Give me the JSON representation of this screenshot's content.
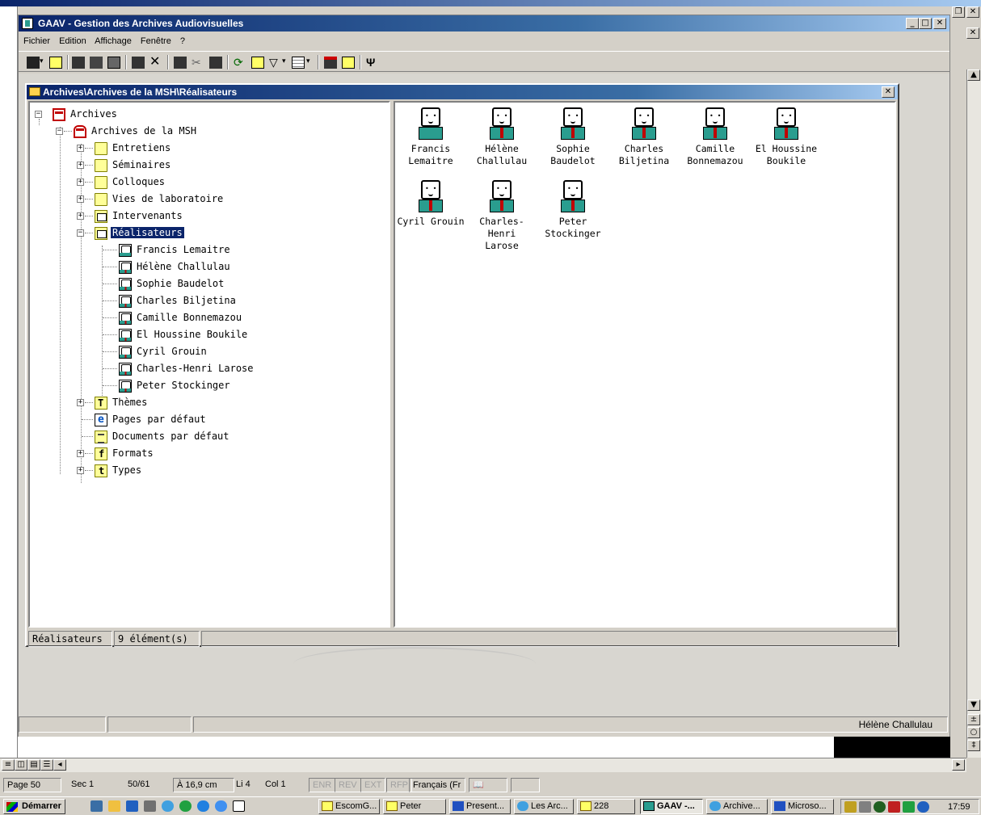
{
  "gaav_window": {
    "title": "GAAV - Gestion des Archives Audiovisuelles",
    "menu": [
      "Fichier",
      "Edition",
      "Affichage",
      "Fenêtre",
      "?"
    ]
  },
  "child_window": {
    "title": "Archives\\Archives de la MSH\\Réalisateurs"
  },
  "tree": {
    "root": "Archives",
    "msh": "Archives de la MSH",
    "folders": [
      "Entretiens",
      "Séminaires",
      "Colloques",
      "Vies de laboratoire"
    ],
    "intervenants": "Intervenants",
    "realisateurs": "Réalisateurs",
    "people": [
      "Francis Lemaitre",
      "Hélène Challulau",
      "Sophie Baudelot",
      "Charles Biljetina",
      "Camille Bonnemazou",
      "El Houssine Boukile",
      "Cyril Grouin",
      "Charles-Henri Larose",
      "Peter Stockinger"
    ],
    "themes": "Thèmes",
    "pages": "Pages par défaut",
    "documents": "Documents par défaut",
    "formats": "Formats",
    "types": "Types"
  },
  "list_view": {
    "items": [
      {
        "line1": "Francis",
        "line2": "Lemaitre"
      },
      {
        "line1": "Hélène",
        "line2": "Challulau"
      },
      {
        "line1": "Sophie",
        "line2": "Baudelot"
      },
      {
        "line1": "Charles",
        "line2": "Biljetina"
      },
      {
        "line1": "Camille",
        "line2": "Bonnemazou"
      },
      {
        "line1": "El Houssine",
        "line2": "Boukile"
      },
      {
        "line1": "Cyril Grouin",
        "line2": ""
      },
      {
        "line1": "Charles-Henri",
        "line2": "Larose"
      },
      {
        "line1": "Peter",
        "line2": "Stockinger"
      }
    ]
  },
  "child_status": {
    "section": "Réalisateurs",
    "count": "9 élément(s)"
  },
  "gaav_status": {
    "selected": "Hélène Challulau"
  },
  "word_status": {
    "page": "Page 50",
    "sec": "Sec 1",
    "pages": "50/61",
    "position": "À 16,9 cm",
    "line": "Li 4",
    "col": "Col 1",
    "enr": "ENR",
    "rev": "REV",
    "ext": "EXT",
    "rfp": "RFP",
    "lang": "Français (Fr"
  },
  "taskbar": {
    "start": "Démarrer",
    "tasks": [
      "EscomG...",
      "Peter",
      "Present...",
      "Les Arc...",
      "228",
      "GAAV -...",
      "Archive...",
      "Microso..."
    ],
    "clock": "17:59"
  },
  "colors": {
    "title_active": "#0a246a",
    "person_body": "#2a9d8f",
    "tie": "#c00000",
    "folder": "#ffff99"
  }
}
